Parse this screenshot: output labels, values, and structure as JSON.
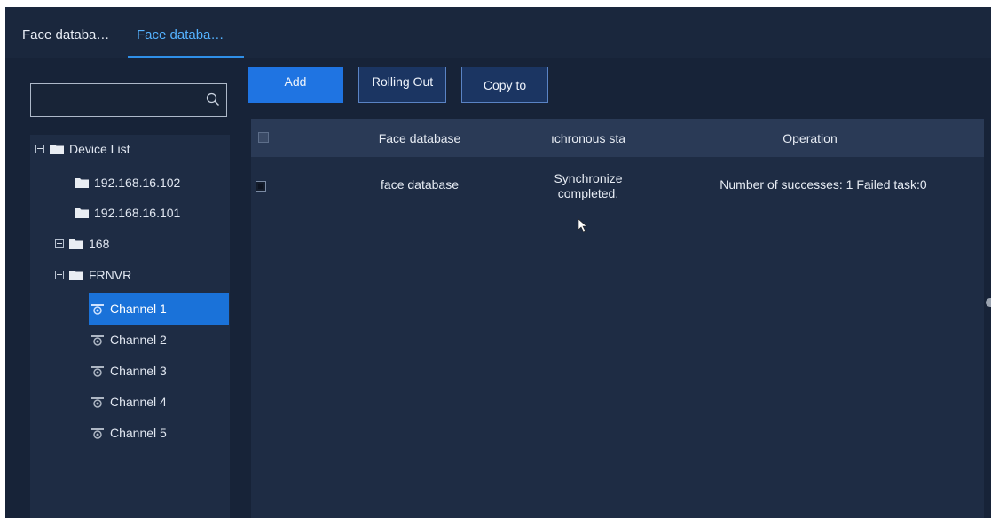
{
  "tabs": [
    {
      "label": "Face databa…",
      "active": false
    },
    {
      "label": "Face databa…",
      "active": true
    }
  ],
  "search": {
    "value": "",
    "placeholder": ""
  },
  "toolbar": {
    "add_label": "Add",
    "rolling_out_label": "Rolling Out",
    "copy_to_label": "Copy to"
  },
  "tree": {
    "root_label": "Device List",
    "nodes": [
      {
        "label": "192.168.16.102"
      },
      {
        "label": "192.168.16.101"
      },
      {
        "label": "168"
      },
      {
        "label": "FRNVR"
      }
    ],
    "channels": [
      {
        "label": "Channel 1",
        "selected": true
      },
      {
        "label": "Channel 2",
        "selected": false
      },
      {
        "label": "Channel 3",
        "selected": false
      },
      {
        "label": "Channel 4",
        "selected": false
      },
      {
        "label": "Channel 5",
        "selected": false
      }
    ]
  },
  "table": {
    "columns": [
      "Face database",
      "ıchronous sta",
      "Operation"
    ],
    "rows": [
      {
        "face_database": "face database",
        "sync_status_line1": "Synchronize",
        "sync_status_line2": "completed.",
        "operation": "Number of successes: 1 Failed task:0"
      }
    ]
  },
  "colors": {
    "background": "#172338",
    "accent": "#1f74e2",
    "active_tab_text": "#54b2ff",
    "selected_row": "#1a72d9"
  }
}
